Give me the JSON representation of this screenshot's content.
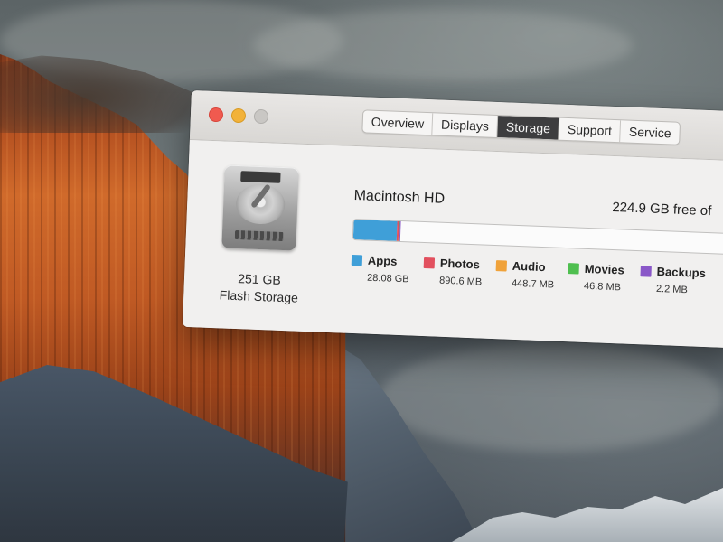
{
  "window": {
    "tabs": [
      {
        "label": "Overview"
      },
      {
        "label": "Displays"
      },
      {
        "label": "Storage"
      },
      {
        "label": "Support"
      },
      {
        "label": "Service"
      }
    ],
    "active_tab": "Storage"
  },
  "disk": {
    "capacity": "251 GB",
    "type": "Flash Storage"
  },
  "volume": {
    "name": "Macintosh HD",
    "free": "224.9 GB free of"
  },
  "categories": [
    {
      "label": "Apps",
      "size": "28.08 GB",
      "color": "#3f9fd8",
      "fraction": 0.112
    },
    {
      "label": "Photos",
      "size": "890.6 MB",
      "color": "#e2505e",
      "fraction": 0.0035
    },
    {
      "label": "Audio",
      "size": "448.7 MB",
      "color": "#f0a23a",
      "fraction": 0.0018
    },
    {
      "label": "Movies",
      "size": "46.8 MB",
      "color": "#4fbf4f",
      "fraction": 0.0002
    },
    {
      "label": "Backups",
      "size": "2.2 MB",
      "color": "#8a58c8",
      "fraction": 1e-05
    }
  ]
}
